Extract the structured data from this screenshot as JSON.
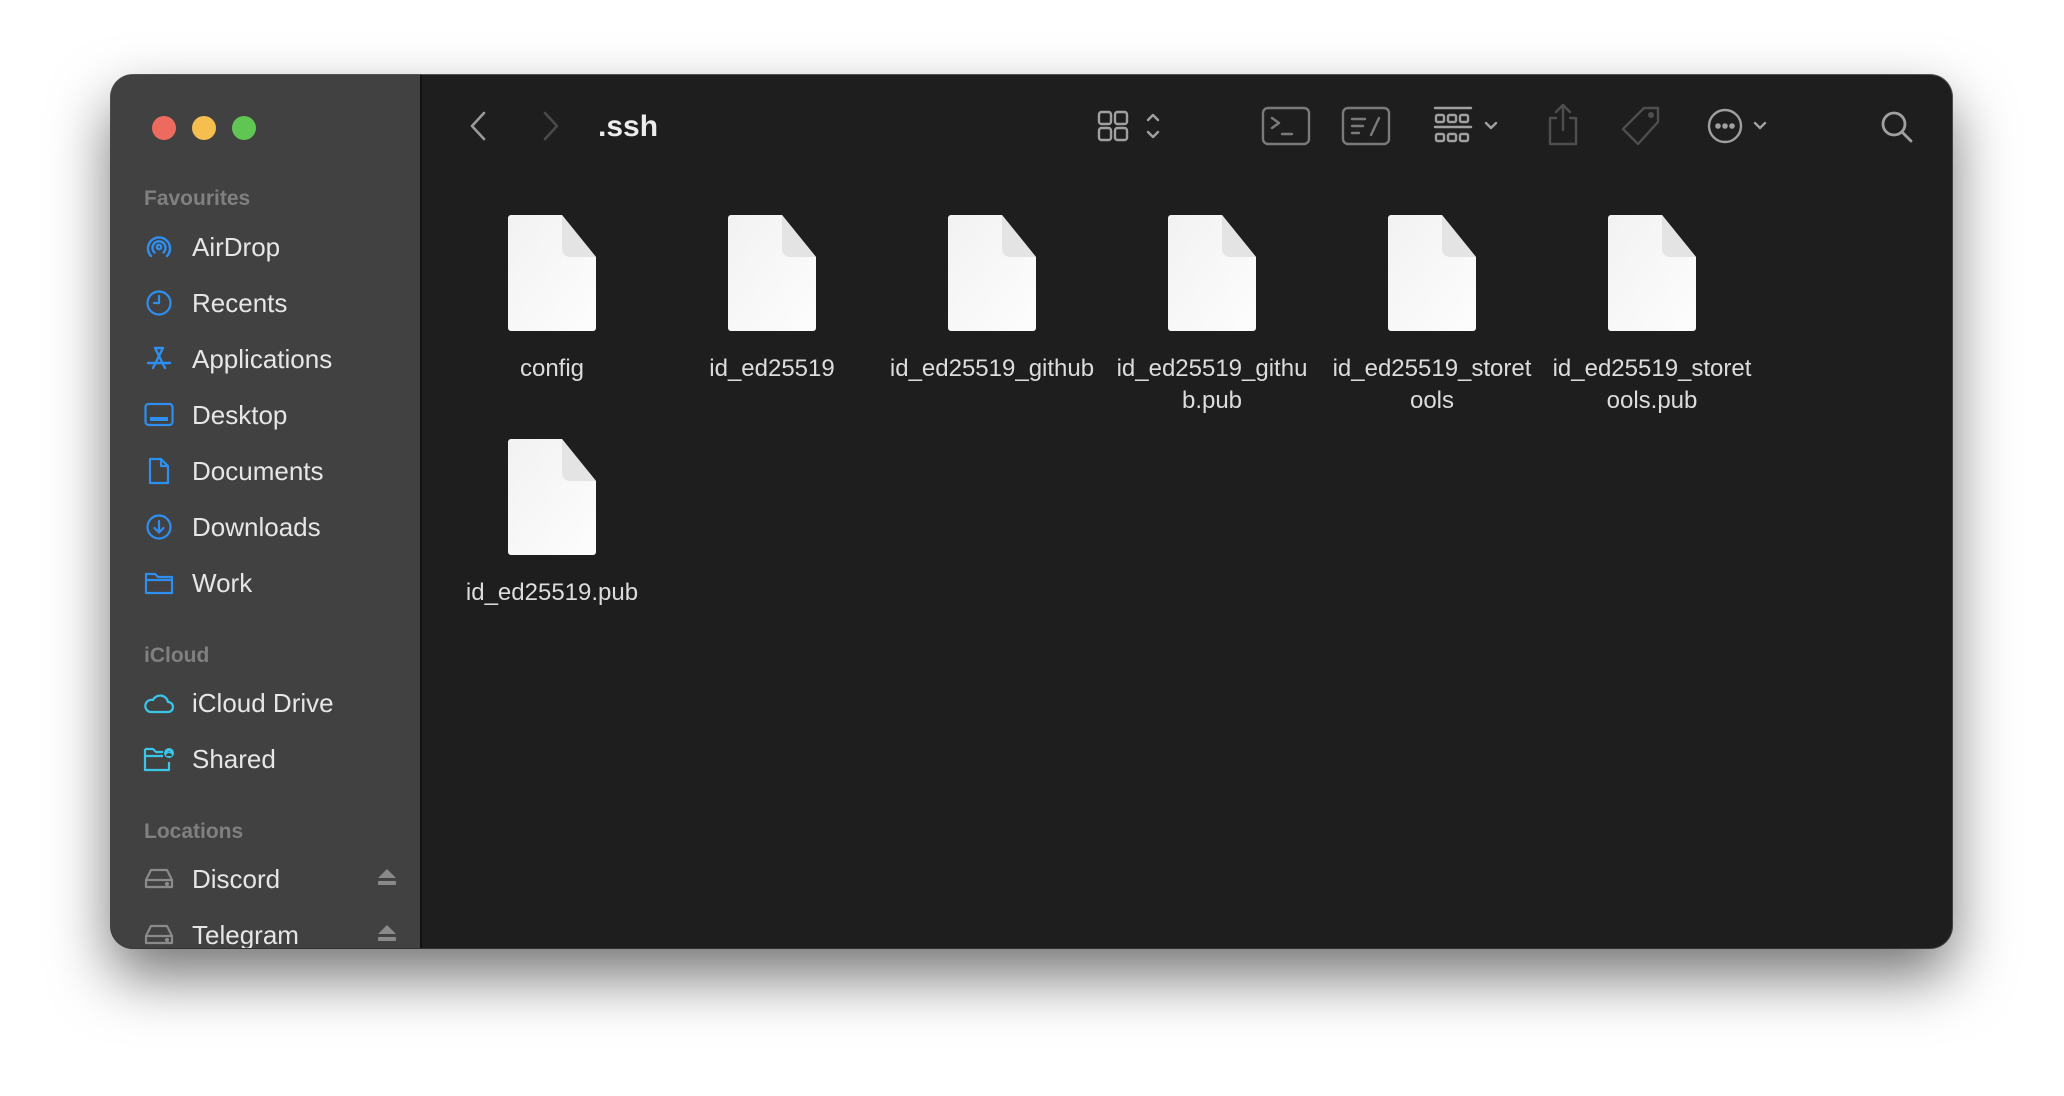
{
  "window": {
    "title": ".ssh",
    "traffic_lights": [
      {
        "name": "close",
        "color": "#ed6a5e"
      },
      {
        "name": "minimize",
        "color": "#f5bf4f"
      },
      {
        "name": "zoom",
        "color": "#61c554"
      }
    ]
  },
  "sidebar": {
    "sections": [
      {
        "header": "Favourites",
        "items": [
          {
            "label": "AirDrop",
            "icon": "airdrop-icon"
          },
          {
            "label": "Recents",
            "icon": "clock-icon"
          },
          {
            "label": "Applications",
            "icon": "applications-icon"
          },
          {
            "label": "Desktop",
            "icon": "desktop-icon"
          },
          {
            "label": "Documents",
            "icon": "document-icon"
          },
          {
            "label": "Downloads",
            "icon": "download-icon"
          },
          {
            "label": "Work",
            "icon": "folder-icon"
          }
        ]
      },
      {
        "header": "iCloud",
        "items": [
          {
            "label": "iCloud Drive",
            "icon": "cloud-icon"
          },
          {
            "label": "Shared",
            "icon": "shared-folder-icon"
          }
        ]
      },
      {
        "header": "Locations",
        "items": [
          {
            "label": "Discord",
            "icon": "drive-icon",
            "ejectable": true
          },
          {
            "label": "Telegram",
            "icon": "drive-icon",
            "ejectable": true
          }
        ]
      }
    ]
  },
  "toolbar": {
    "back": "back-chevron-icon",
    "forward": "forward-chevron-icon",
    "view_mode": "icon-grid-view",
    "buttons": [
      "terminal-icon",
      "edit-icon",
      "group-icon",
      "share-icon",
      "tag-icon",
      "more-icon",
      "search-icon"
    ]
  },
  "files": [
    {
      "name": "config"
    },
    {
      "name": "id_ed25519"
    },
    {
      "name": "id_ed25519_github"
    },
    {
      "name": "id_ed25519_github.pub"
    },
    {
      "name": "id_ed25519_storetools"
    },
    {
      "name": "id_ed25519_storetools.pub"
    },
    {
      "name": "id_ed25519.pub"
    }
  ],
  "colors": {
    "accent_blue": "#2e8ff0",
    "icloud_cyan": "#3bc6e8",
    "sidebar_bg": "#414141",
    "content_bg": "#1f1e1f"
  }
}
